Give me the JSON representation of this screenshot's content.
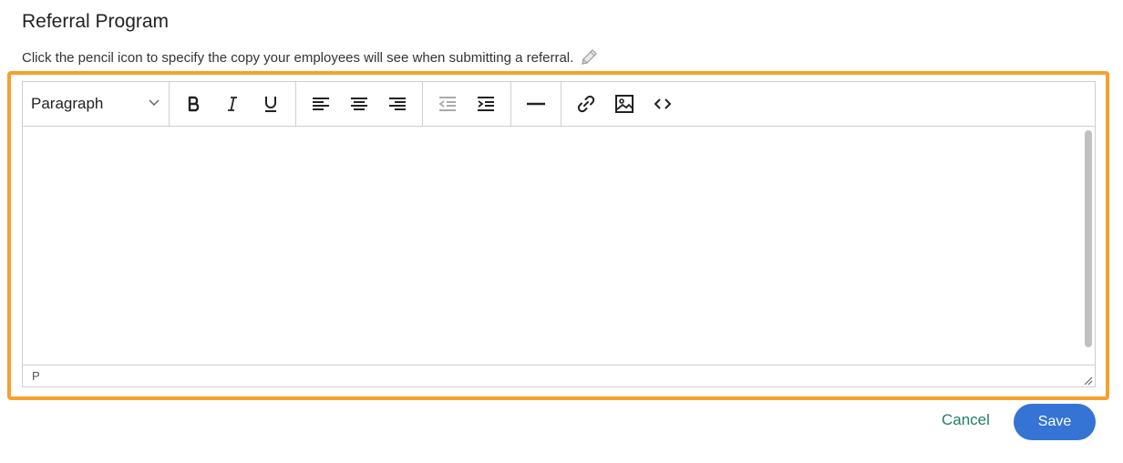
{
  "header": {
    "title": "Referral Program",
    "description": "Click the pencil icon to specify the copy your employees will see when submitting a referral."
  },
  "icons": {
    "edit": "pencil-icon",
    "format_dropdown": "chevron-down-icon",
    "bold": "bold-icon",
    "italic": "italic-icon",
    "underline": "underline-icon",
    "align_left": "align-left-icon",
    "align_center": "align-center-icon",
    "align_right": "align-right-icon",
    "outdent": "outdent-icon",
    "indent": "indent-icon",
    "horizontal_rule": "horizontal-rule-icon",
    "link": "link-icon",
    "image": "image-icon",
    "source_code": "code-icon",
    "resize": "resize-handle-icon"
  },
  "editor": {
    "format_value": "Paragraph",
    "content": "",
    "status_path": "P"
  },
  "actions": {
    "cancel_label": "Cancel",
    "save_label": "Save"
  },
  "colors": {
    "highlight_border": "#f6a02e",
    "save_button": "#3574d4",
    "cancel_link": "#20815c"
  }
}
